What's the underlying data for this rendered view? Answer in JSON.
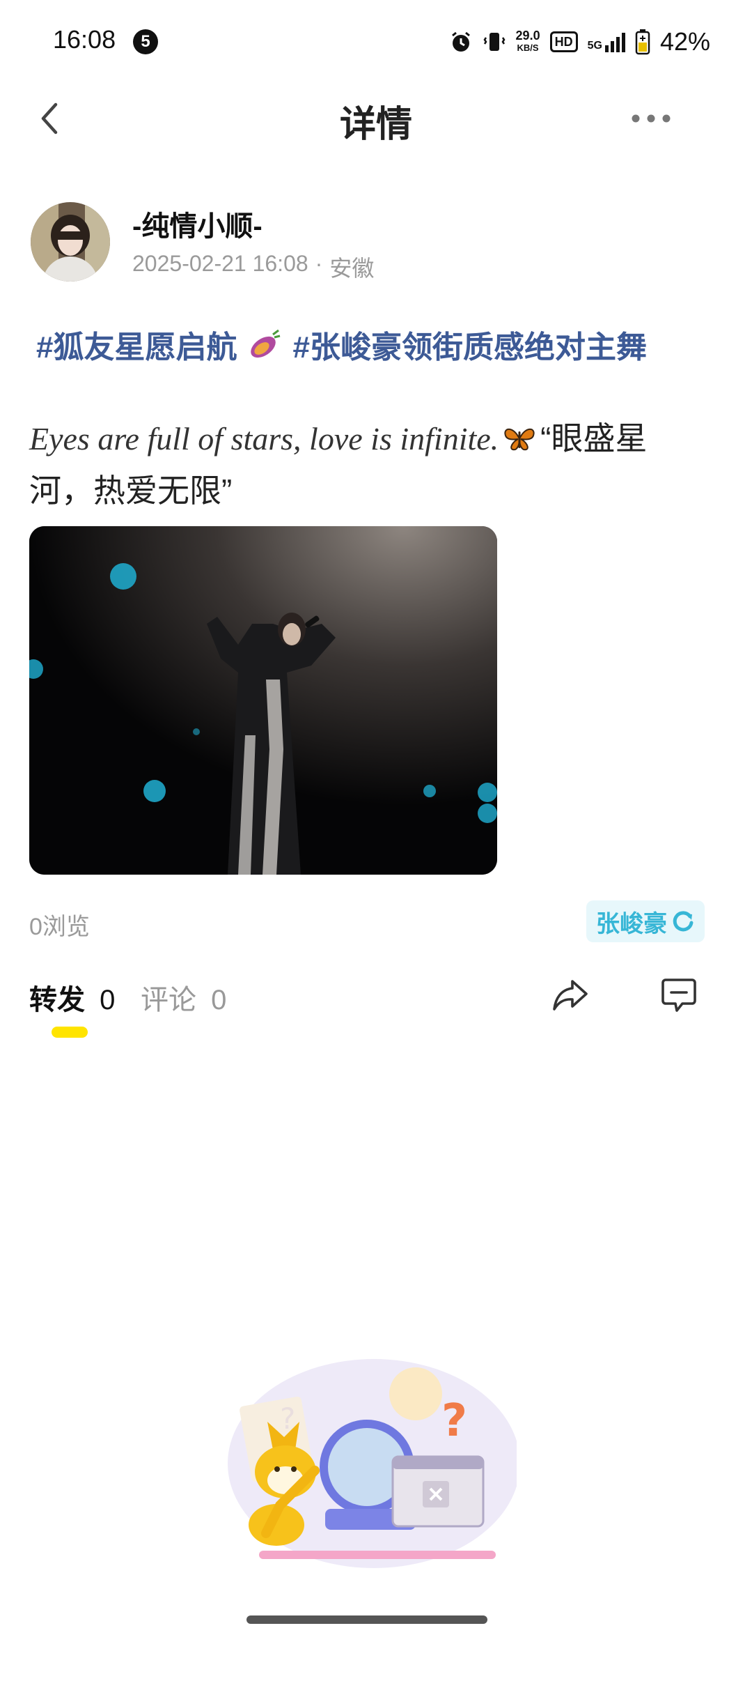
{
  "status_bar": {
    "time": "16:08",
    "notification_count": "5",
    "net_speed_value": "29.0",
    "net_speed_unit": "KB/S",
    "hd_label": "HD",
    "signal_label": "5G",
    "battery": "42%"
  },
  "header": {
    "title": "详情",
    "back_icon": "chevron-left-icon",
    "more_icon": "more-dots-icon"
  },
  "post": {
    "author": "-纯情小顺-",
    "date": "2025-02-21 16:08",
    "separator": "·",
    "location": "安徽",
    "topics": [
      "#狐友星愿启航",
      "#张峻豪领街质感绝对主舞"
    ],
    "text_en": "Eyes are full of stars, love is infinite.",
    "text_zh": "“眼盛星河，热爱无限”",
    "views": "0浏览",
    "star_tag": "张峻豪"
  },
  "tabs": {
    "forward_label": "转发",
    "forward_count": "0",
    "comment_label": "评论",
    "comment_count": "0"
  },
  "colors": {
    "topic": "#3d5a96",
    "tab_underline": "#ffe400",
    "star_tag_text": "#37b6d6",
    "star_tag_bg": "#e7f7fb"
  }
}
